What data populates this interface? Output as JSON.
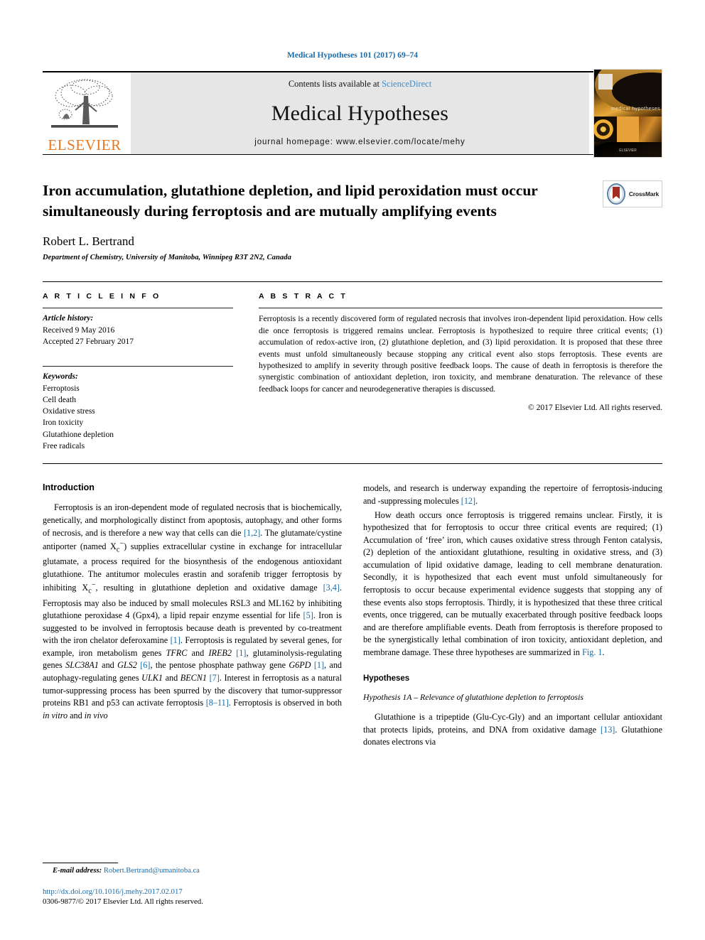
{
  "running_head": "Medical Hypotheses 101 (2017) 69–74",
  "masthead": {
    "publisher": "ELSEVIER",
    "contents_prefix": "Contents lists available at ",
    "contents_link": "ScienceDirect",
    "journal_title": "Medical Hypotheses",
    "homepage": "journal homepage: www.elsevier.com/locate/mehy",
    "cover_label": "medical hypotheses",
    "cover_footer": "ELSEVIER"
  },
  "article": {
    "title": "Iron accumulation, glutathione depletion, and lipid peroxidation must occur simultaneously during ferroptosis and are mutually amplifying events",
    "author": "Robert L. Bertrand",
    "affiliation": "Department of Chemistry, University of Manitoba, Winnipeg R3T 2N2, Canada",
    "crossmark_label": "CrossMark"
  },
  "article_info": {
    "heading": "A R T I C L E    I N F O",
    "history_label": "Article history:",
    "received": "Received 9 May 2016",
    "accepted": "Accepted 27 February 2017",
    "keywords_label": "Keywords:",
    "keywords": [
      "Ferroptosis",
      "Cell death",
      "Oxidative stress",
      "Iron toxicity",
      "Glutathione depletion",
      "Free radicals"
    ]
  },
  "abstract": {
    "heading": "A B S T R A C T",
    "text": "Ferroptosis is a recently discovered form of regulated necrosis that involves iron-dependent lipid peroxidation. How cells die once ferroptosis is triggered remains unclear. Ferroptosis is hypothesized to require three critical events; (1) accumulation of redox-active iron, (2) glutathione depletion, and (3) lipid peroxidation. It is proposed that these three events must unfold simultaneously because stopping any critical event also stops ferroptosis. These events are hypothesized to amplify in severity through positive feedback loops. The cause of death in ferroptosis is therefore the synergistic combination of antioxidant depletion, iron toxicity, and membrane denaturation. The relevance of these feedback loops for cancer and neurodegenerative therapies is discussed.",
    "copyright": "© 2017 Elsevier Ltd. All rights reserved."
  },
  "body": {
    "intro_heading": "Introduction",
    "intro_p1_a": "Ferroptosis is an iron-dependent mode of regulated necrosis that is biochemically, genetically, and morphologically distinct from apoptosis, autophagy, and other forms of necrosis, and is therefore a new way that cells can die ",
    "ref_1_2": "[1,2]",
    "intro_p1_b": ". The glutamate/cystine antiporter (named X",
    "antiporter_sub": "c",
    "antiporter_sup": "−",
    "intro_p1_c": ") supplies extracellular cystine in exchange for intracellular glutamate, a process required for the biosynthesis of the endogenous antioxidant glutathione. The antitumor molecules erastin and sorafenib trigger ferroptosis by inhibiting X",
    "intro_p1_d": ", resulting in glutathione depletion and oxidative damage ",
    "ref_3_4": "[3,4]",
    "intro_p1_e": ". Ferroptosis may also be induced by small molecules RSL3 and ML162 by inhibiting glutathione peroxidase 4 (Gpx4), a lipid repair enzyme essential for life ",
    "ref_5": "[5]",
    "intro_p1_f": ". Iron is suggested to be involved in ferroptosis because death is prevented by co-treatment with the iron chelator deferoxamine ",
    "ref_1": "[1]",
    "intro_p1_g": ". Ferroptosis is regulated by several genes, for example, iron metabolism genes ",
    "gene_tfrc": "TFRC",
    "intro_p1_h": " and ",
    "gene_ireb2": "IREB2",
    "intro_p1_i": ", glutaminolysis-regulating genes ",
    "gene_slc38a1": "SLC38A1",
    "gene_gls2": "GLS2",
    "ref_6": "[6]",
    "intro_p1_j": ", the pentose phosphate pathway gene ",
    "gene_g6pd": "G6PD",
    "intro_p1_k": ", and autophagy-regulating genes ",
    "gene_ulk1": "ULK1",
    "gene_becn1": "BECN1",
    "ref_7": "[7]",
    "intro_p1_l": ". Interest in ferroptosis as a natural tumor-suppressing process has been spurred by the discovery that tumor-suppressor proteins RB1 and p53 can activate ferroptosis ",
    "ref_8_11": "[8–11]",
    "intro_p1_m": ". Ferroptosis is observed in both ",
    "in_vitro": "in vitro",
    "in_vivo": "in vivo",
    "intro_p1_n": " models, and research is underway expanding the repertoire of ferroptosis-inducing and -suppressing molecules ",
    "ref_12": "[12]",
    "intro_p1_o": ".",
    "intro_p2_a": "How death occurs once ferroptosis is triggered remains unclear. Firstly, it is hypothesized that for ferroptosis to occur three critical events are required; (1) Accumulation of ‘free’ iron, which causes oxidative stress through Fenton catalysis, (2) depletion of the antioxidant glutathione, resulting in oxidative stress, and (3) accumulation of lipid oxidative damage, leading to cell membrane denaturation. Secondly, it is hypothesized that each event must unfold simultaneously for ferroptosis to occur because experimental evidence suggests that stopping any of these events also stops ferroptosis. Thirdly, it is hypothesized that these three critical events, once triggered, can be mutually exacerbated through positive feedback loops and are therefore amplifiable events. Death from ferroptosis is therefore proposed to be the synergistically lethal combination of iron toxicity, antioxidant depletion, and membrane damage. These three hypotheses are summarized in ",
    "fig_1_ref": "Fig. 1",
    "intro_p2_b": ".",
    "hypotheses_heading": "Hypotheses",
    "hypothesis_1a_heading": "Hypothesis 1A – Relevance of glutathione depletion to ferroptosis",
    "hyp_p1_a": "Glutathione is a tripeptide (Glu-Cyc-Gly) and an important cellular antioxidant that protects lipids, proteins, and DNA from oxidative damage ",
    "ref_13": "[13]",
    "hyp_p1_b": ". Glutathione donates electrons via"
  },
  "footnote": {
    "email_label": "E-mail address:",
    "email": "Robert.Bertrand@umanitoba.ca",
    "doi": "http://dx.doi.org/10.1016/j.mehy.2017.02.017",
    "issn_copyright": "0306-9877/© 2017 Elsevier Ltd. All rights reserved."
  },
  "colors": {
    "link": "#1a6ba8",
    "elsevier_orange": "#E87722",
    "masthead_gray": "#e6e6e6"
  }
}
